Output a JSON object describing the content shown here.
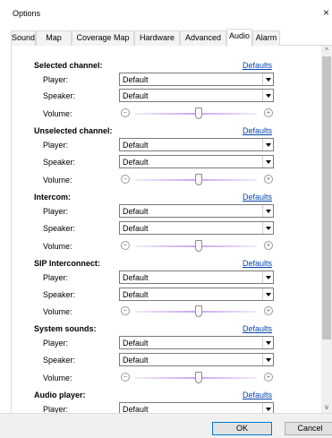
{
  "window": {
    "title": "Options",
    "close": "×"
  },
  "tabs": [
    "Sound",
    "Map",
    "Coverage Map",
    "Hardware",
    "Advanced",
    "Audio",
    "Alarm"
  ],
  "active_tab": "Audio",
  "common": {
    "defaults_label": "Defaults",
    "player_label": "Player:",
    "speaker_label": "Speaker:",
    "volume_label": "Volume:",
    "default_value": "Default",
    "volume_minus": "−",
    "volume_plus": "+"
  },
  "sections": [
    {
      "title": "Selected channel:",
      "player": "Default",
      "speaker": "Default",
      "volume": 0.5
    },
    {
      "title": "Unselected channel:",
      "player": "Default",
      "speaker": "Default",
      "volume": 0.5
    },
    {
      "title": "Intercom:",
      "player": "Default",
      "speaker": "Default",
      "volume": 0.5
    },
    {
      "title": "SIP Interconnect:",
      "player": "Default",
      "speaker": "Default",
      "volume": 0.5
    },
    {
      "title": "System sounds:",
      "player": "Default",
      "speaker": "Default",
      "volume": 0.5
    },
    {
      "title": "Audio player:",
      "player": "Default"
    }
  ],
  "buttons": {
    "ok": "OK",
    "cancel": "Cancel"
  },
  "scrollbar": {
    "up": "^",
    "down": "v"
  }
}
